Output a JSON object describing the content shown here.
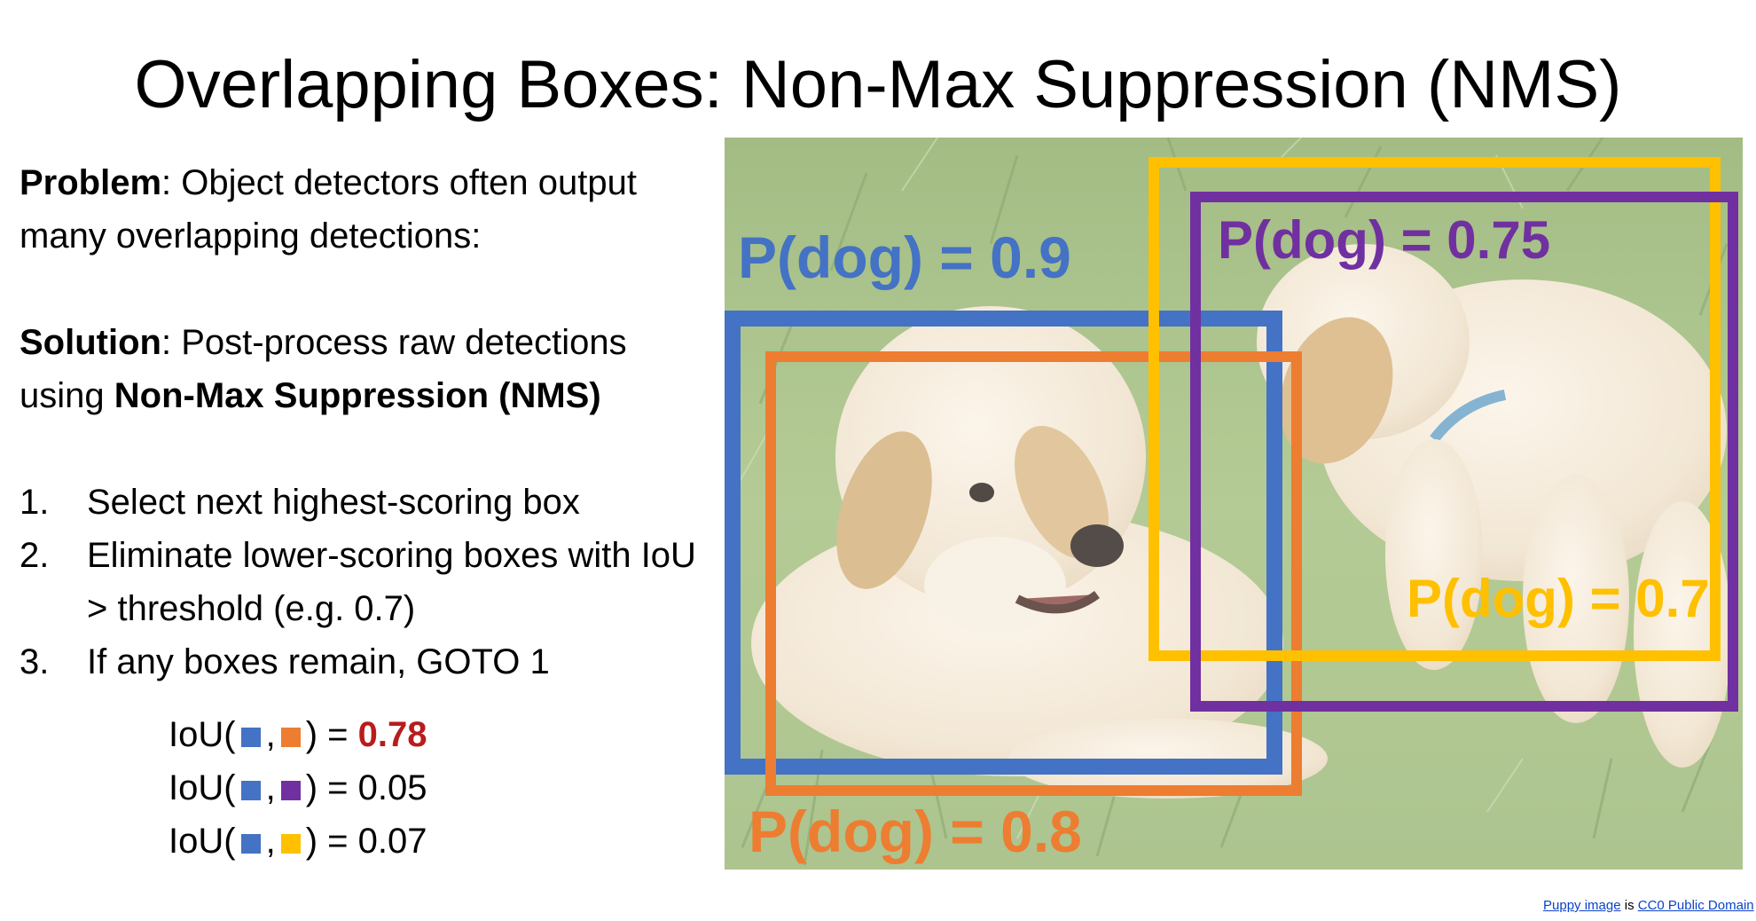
{
  "title": "Overlapping Boxes: Non-Max Suppression (NMS)",
  "problem": {
    "label": "Problem",
    "text": ": Object detectors often output many overlapping detections:"
  },
  "solution": {
    "label": "Solution",
    "text": ": Post-process raw detections using ",
    "bold_tail": "Non-Max Suppression (NMS)"
  },
  "steps": [
    {
      "num": "1.",
      "text": "Select next highest-scoring box"
    },
    {
      "num": "2.",
      "text": "Eliminate lower-scoring boxes with IoU > threshold (e.g. 0.7)"
    },
    {
      "num": "3.",
      "text": "If any boxes remain, GOTO 1"
    }
  ],
  "iou": [
    {
      "prefix": "IoU(",
      "sep": ",",
      "suffix": ") = ",
      "value": "0.78",
      "a_color": "#4472c4",
      "b_color": "#ed7d31",
      "highlight": true
    },
    {
      "prefix": "IoU(",
      "sep": ",",
      "suffix": ") = ",
      "value": "0.05",
      "a_color": "#4472c4",
      "b_color": "#7030a0",
      "highlight": false
    },
    {
      "prefix": "IoU(",
      "sep": ",",
      "suffix": ") = ",
      "value": "0.07",
      "a_color": "#4472c4",
      "b_color": "#ffc000",
      "highlight": false
    }
  ],
  "detections": [
    {
      "label": "P(dog) = 0.9",
      "color": "#4472c4"
    },
    {
      "label": "P(dog) = 0.8",
      "color": "#ed7d31"
    },
    {
      "label": "P(dog) = 0.75",
      "color": "#7030a0"
    },
    {
      "label": "P(dog) = 0.7",
      "color": "#ffc000"
    }
  ],
  "credit": {
    "link1": "Puppy image",
    "mid": " is ",
    "link2": "CC0 Public Domain"
  }
}
